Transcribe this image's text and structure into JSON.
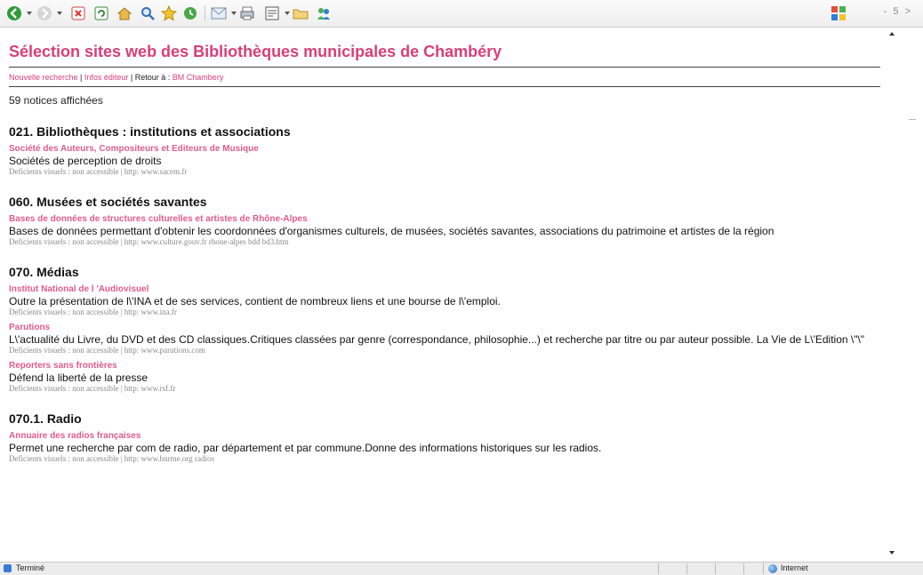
{
  "toolbar": {
    "right_controls": "- 5 >"
  },
  "colors": {
    "accent": "#d83f78",
    "meta_gray": "#8a8a8a"
  },
  "header": {
    "title": "Sélection sites web des Bibliothèques municipales de Chambéry",
    "nav": {
      "new_search": "Nouvelle recherche",
      "sep1": " | ",
      "publisher_info": "Infos éditeur",
      "sep2": " | ",
      "back_to": "Retour à : ",
      "back_link": "BM Chambery"
    },
    "count": "59 notices affichées"
  },
  "sections": [
    {
      "heading": "021. Bibliothèques : institutions et associations",
      "records": [
        {
          "title": "Société des Auteurs, Compositeurs et Editeurs de Musique",
          "desc": "Sociétés de perception de droits",
          "meta": "Deficients visuels : non accessible | http:  www.sacem.fr"
        }
      ]
    },
    {
      "heading": "060. Musées et sociétés savantes",
      "records": [
        {
          "title": "Bases de données de structures culturelles et artistes de Rhône-Alpes",
          "desc": "Bases de données permettant d'obtenir les coordonnées d'organismes culturels, de musées, sociétés savantes, associations du patrimoine et artistes de la région",
          "meta": "Deficients visuels : non accessible | http:  www.culture.gouv.fr rhone-alpes bdd bd3.htm"
        }
      ]
    },
    {
      "heading": "070. Médias",
      "records": [
        {
          "title": "Institut National de l 'Audiovisuel",
          "desc": "Outre la présentation de l\\'INA et de ses services, contient de nombreux liens et une bourse de l\\'emploi.",
          "meta": "Deficients visuels : non accessible | http:  www.ina.fr"
        },
        {
          "title": "Parutions",
          "desc": "L\\'actualité du Livre, du DVD et des CD classiques.Critiques classées par genre (correspondance, philosophie...) et recherche par titre ou par auteur possible. La Vie de L\\'Edition \\\"\\\"",
          "meta": "Deficients visuels : non accessible | http:  www.parutions.com"
        },
        {
          "title": "Reporters sans frontières",
          "desc": "Défend la liberté de la presse",
          "meta": "Deficients visuels : non accessible | http:  www.rsf.fr"
        }
      ]
    },
    {
      "heading": "070.1. Radio",
      "records": [
        {
          "title": "Annuaire des radios françaises",
          "desc": "Permet une recherche par com de radio, par département et par commune.Donne des informations historiques sur les radios.",
          "meta": "Deficients visuels : non accessible | http:  www.bnrme.org radios"
        }
      ]
    }
  ],
  "statusbar": {
    "status": "Terminé",
    "zone": "Internet"
  }
}
